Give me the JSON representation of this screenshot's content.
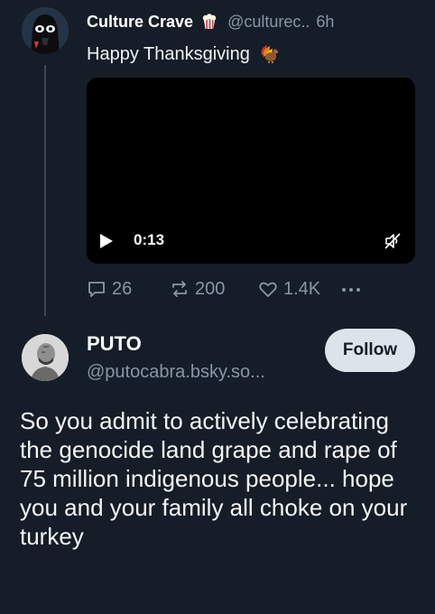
{
  "post1": {
    "author_name": "Culture Crave",
    "author_emoji_icon": "popcorn-icon",
    "handle": "@culturec..",
    "time": "6h",
    "text": "Happy Thanksgiving",
    "text_emoji_icon": "turkey-icon",
    "video": {
      "duration": "0:13",
      "play_icon": "play-icon",
      "mute_icon": "muted-speaker-icon"
    },
    "stats": {
      "replies": "26",
      "reposts": "200",
      "likes": "1.4K"
    }
  },
  "post2": {
    "author_name": "PUTO",
    "handle": "@putocabra.bsky.so...",
    "follow_label": "Follow",
    "text": "So you admit to actively celebrating the genocide land grape and rape of 75 million indigenous people... hope you and your family all choke on your turkey"
  },
  "colors": {
    "background": "#151d28",
    "muted": "#8796a8",
    "follow_bg": "#dde3ea"
  }
}
